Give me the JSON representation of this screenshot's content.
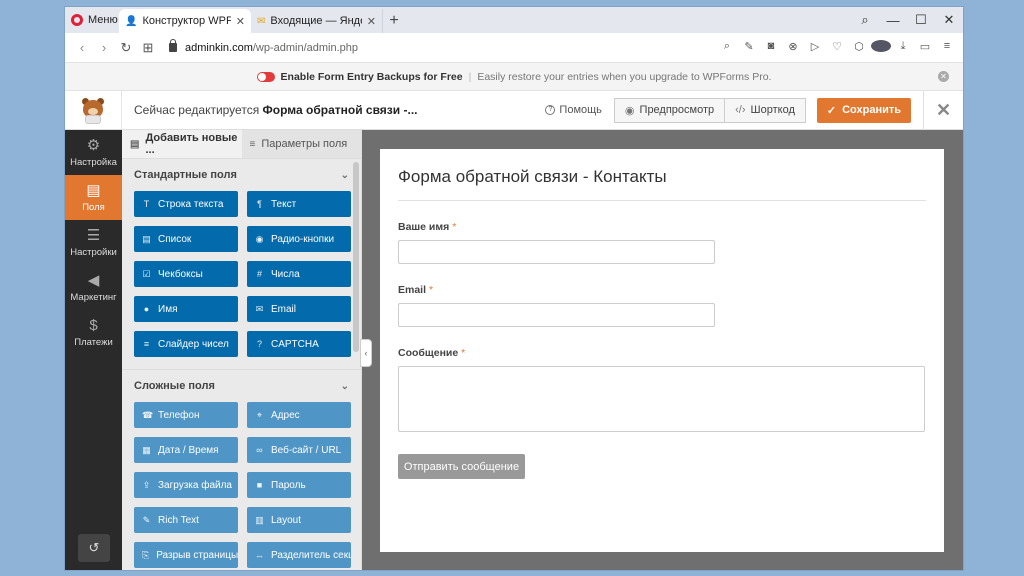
{
  "browser": {
    "menu_label": "Меню",
    "tabs": [
      {
        "label": "Конструктор WPForms ‹ A",
        "icon": "user-icon"
      },
      {
        "label": "Входящие — Яндекс Почт",
        "icon": "mail-icon"
      }
    ],
    "url_host": "adminkin.com",
    "url_path": "/wp-admin/admin.php"
  },
  "notice": {
    "title": "Enable Form Entry Backups for Free",
    "text": "Easily restore your entries when you upgrade to WPForms Pro."
  },
  "header": {
    "editing_prefix": "Сейчас редактируется",
    "form_name": "Форма обратной связи -...",
    "help": "Помощь",
    "preview": "Предпросмотр",
    "shortcode": "Шорткод",
    "save": "Сохранить"
  },
  "sidebar": {
    "items": [
      {
        "label": "Настройка",
        "icon": "gear-icon",
        "active": false
      },
      {
        "label": "Поля",
        "icon": "fields-icon",
        "active": true
      },
      {
        "label": "Настройки",
        "icon": "sliders-icon",
        "active": false
      },
      {
        "label": "Маркетинг",
        "icon": "megaphone-icon",
        "active": false
      },
      {
        "label": "Платежи",
        "icon": "dollar-icon",
        "active": false
      }
    ]
  },
  "panel": {
    "tab_add": "Добавить новые ...",
    "tab_options": "Параметры поля",
    "standard_title": "Стандартные поля",
    "standard_fields": [
      {
        "label": "Строка текста",
        "icon": "T"
      },
      {
        "label": "Текст",
        "icon": "¶"
      },
      {
        "label": "Список",
        "icon": "▤"
      },
      {
        "label": "Радио-кнопки",
        "icon": "◉"
      },
      {
        "label": "Чекбоксы",
        "icon": "☑"
      },
      {
        "label": "Числа",
        "icon": "#"
      },
      {
        "label": "Имя",
        "icon": "●"
      },
      {
        "label": "Email",
        "icon": "✉"
      },
      {
        "label": "Слайдер чисел",
        "icon": "≡"
      },
      {
        "label": "CAPTCHA",
        "icon": "?"
      }
    ],
    "fancy_title": "Сложные поля",
    "fancy_fields": [
      {
        "label": "Телефон",
        "icon": "☎"
      },
      {
        "label": "Адрес",
        "icon": "⌖"
      },
      {
        "label": "Дата / Время",
        "icon": "▦"
      },
      {
        "label": "Веб-сайт / URL",
        "icon": "∞"
      },
      {
        "label": "Загрузка файла",
        "icon": "⇪"
      },
      {
        "label": "Пароль",
        "icon": "■"
      },
      {
        "label": "Rich Text",
        "icon": "✎"
      },
      {
        "label": "Layout",
        "icon": "▥"
      },
      {
        "label": "Разрыв страницы",
        "icon": "⎘"
      },
      {
        "label": "Разделитель секц...",
        "icon": "↔"
      }
    ]
  },
  "form": {
    "title": "Форма обратной связи - Контакты",
    "fields": [
      {
        "label": "Ваше имя",
        "type": "input"
      },
      {
        "label": "Email",
        "type": "input"
      },
      {
        "label": "Сообщение",
        "type": "textarea"
      }
    ],
    "required_mark": "*",
    "submit": "Отправить сообщение"
  },
  "colors": {
    "accent": "#e27730",
    "field_button": "#036aab",
    "sidebar_bg": "#2a2a2a"
  }
}
